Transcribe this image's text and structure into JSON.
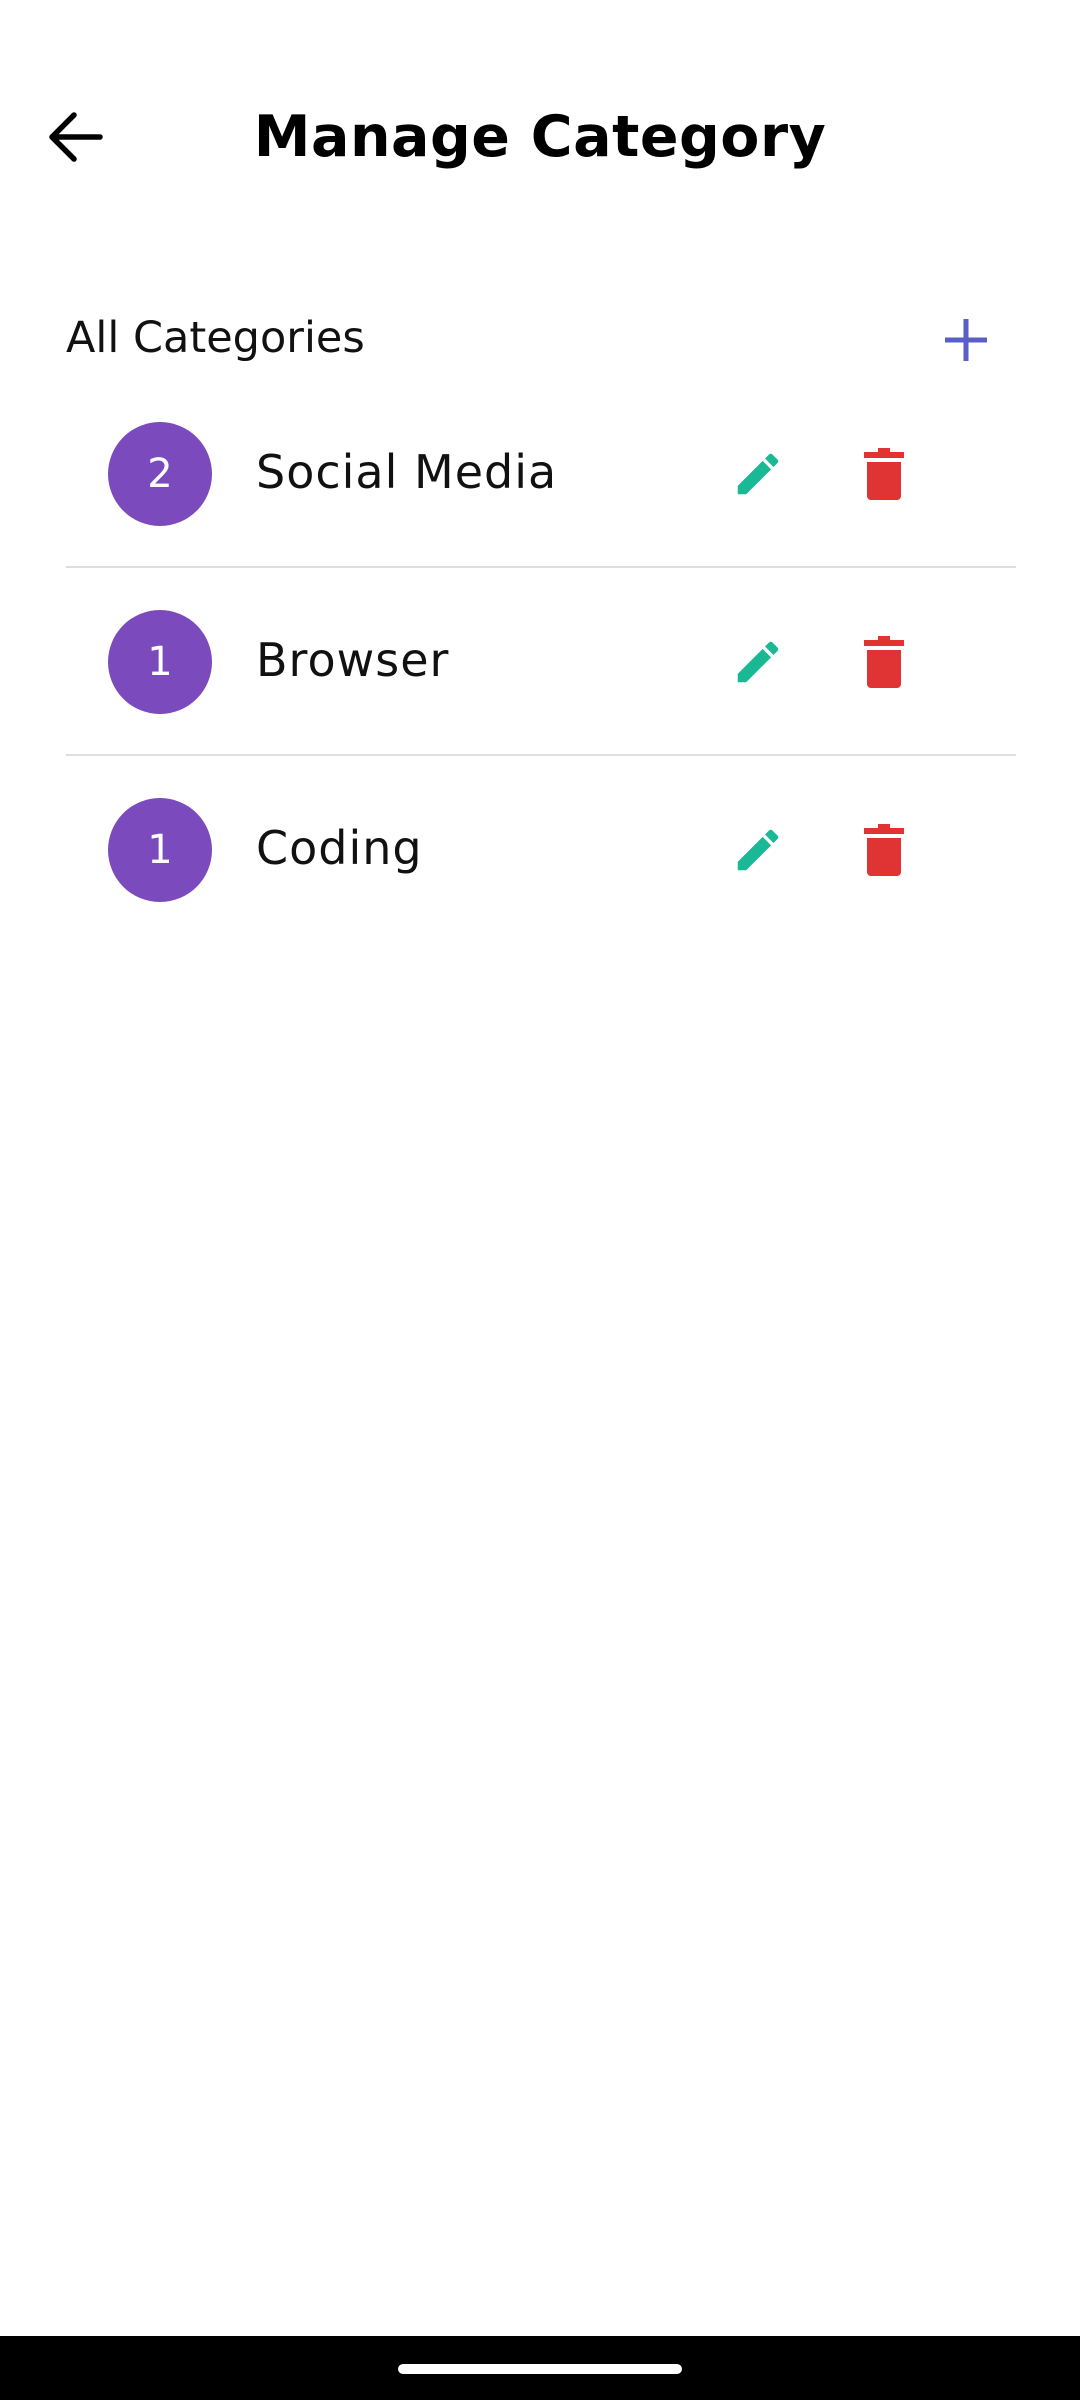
{
  "header": {
    "title": "Manage Category",
    "back_icon": "arrow-left-icon"
  },
  "section": {
    "title": "All Categories",
    "add_icon": "plus-icon"
  },
  "categories": [
    {
      "count": "2",
      "name": "Social Media"
    },
    {
      "count": "1",
      "name": "Browser"
    },
    {
      "count": "1",
      "name": "Coding"
    }
  ],
  "row_icons": {
    "edit": "pencil-icon",
    "delete": "trash-icon"
  },
  "colors": {
    "badge": "#7b4bbd",
    "edit": "#1ab894",
    "delete": "#e03333",
    "add": "#5a5fc8"
  }
}
